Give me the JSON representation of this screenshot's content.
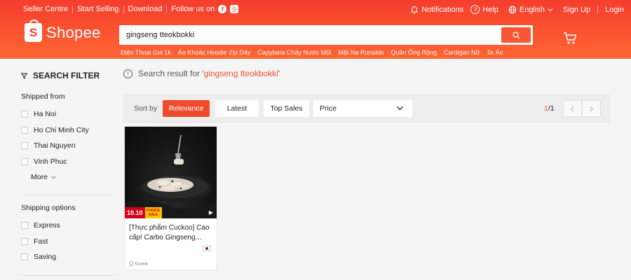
{
  "topbar": {
    "seller_centre": "Seller Centre",
    "start_selling": "Start Selling",
    "download": "Download",
    "follow_us": "Follow us on",
    "notifications": "Notifications",
    "help": "Help",
    "language": "English",
    "sign_up": "Sign Up",
    "login": "Login"
  },
  "brand": {
    "name": "Shopee",
    "logo_letter": "S"
  },
  "search": {
    "value": "gingseng tteokbokki",
    "suggestions": [
      "Điện Thoại Giá 1k",
      "Áo Khoác Hoodie Zip Dây",
      "Capybara Chảy Nước Mũi",
      "Mặt Nạ Ronaldo",
      "Quần Ống Rộng",
      "Cardigan Nữ",
      "1k Áo"
    ]
  },
  "sidebar": {
    "title": "SEARCH FILTER",
    "shipped_from": {
      "label": "Shipped from",
      "options": [
        "Ha Noi",
        "Ho Chi Minh City",
        "Thai Nguyen",
        "Vinh Phuc"
      ],
      "more": "More"
    },
    "shipping_options": {
      "label": "Shipping options",
      "options": [
        "Express",
        "Fast",
        "Saving"
      ]
    }
  },
  "result": {
    "prefix": "Search result for '",
    "keyword": "gingseng tteokbokki",
    "suffix": "'"
  },
  "sort": {
    "label": "Sort by",
    "relevance": "Relevance",
    "latest": "Latest",
    "top_sales": "Top Sales",
    "price": "Price",
    "page_current": "1",
    "page_total": "/1"
  },
  "product": {
    "title": "[Thực phẩm Cuckoo] Cao cấp! Carbo Gingseng…",
    "badge_date": "10.10",
    "badge_text": "CHOICE SALE",
    "location": "Korea"
  },
  "colors": {
    "brand": "#ee4d2d",
    "header_top": "#f53d2d",
    "header_bottom": "#ff6633"
  }
}
